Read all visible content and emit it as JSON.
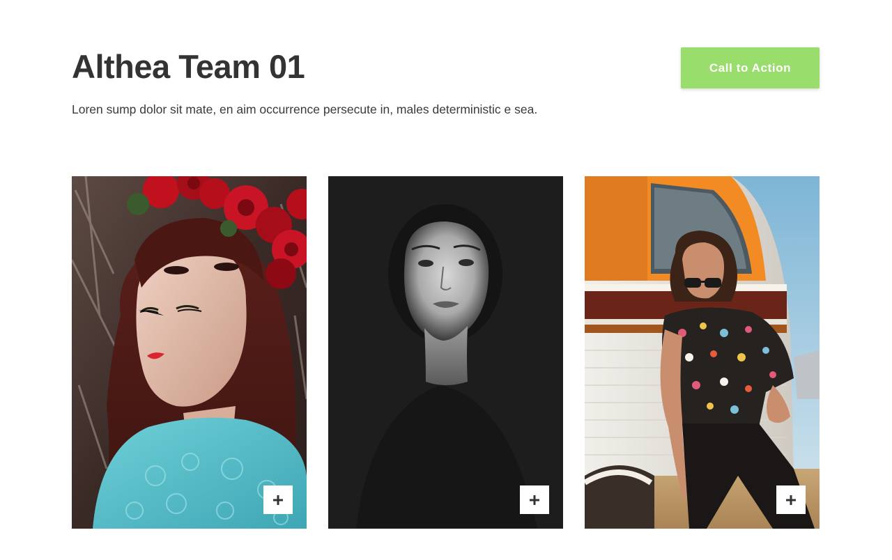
{
  "header": {
    "title": "Althea Team 01",
    "subtitle": "Loren sump dolor sit mate, en aim occurrence persecute in, males deterministic e sea."
  },
  "cta": {
    "label": "Call to Action",
    "color": "#99dd6c"
  },
  "team": [
    {
      "photo": "woman-with-red-rose-crown-portrait",
      "action_icon": "plus-icon"
    },
    {
      "photo": "black-and-white-woman-portrait",
      "action_icon": "plus-icon"
    },
    {
      "photo": "woman-with-sunglasses-by-retro-van",
      "action_icon": "plus-icon"
    }
  ]
}
